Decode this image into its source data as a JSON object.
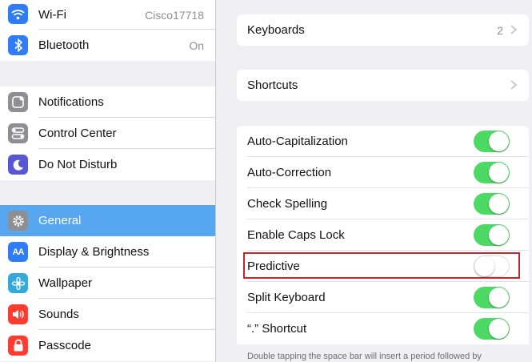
{
  "sidebar": {
    "group1": [
      {
        "label": "Wi-Fi",
        "value": "Cisco17718",
        "icon": "wifi-icon",
        "color": "#2f7cf6"
      },
      {
        "label": "Bluetooth",
        "value": "On",
        "icon": "bluetooth-icon",
        "color": "#2f7cf6"
      }
    ],
    "group2": [
      {
        "label": "Notifications",
        "icon": "notifications-icon",
        "color": "#8e8e93"
      },
      {
        "label": "Control Center",
        "icon": "control-center-icon",
        "color": "#8e8e93"
      },
      {
        "label": "Do Not Disturb",
        "icon": "moon-icon",
        "color": "#5856d6"
      }
    ],
    "group3": [
      {
        "label": "General",
        "icon": "gear-icon",
        "color": "#8e8e93",
        "active": true
      },
      {
        "label": "Display & Brightness",
        "icon": "display-brightness-icon",
        "color": "#2f7cf6"
      },
      {
        "label": "Wallpaper",
        "icon": "wallpaper-icon",
        "color": "#34aadc"
      },
      {
        "label": "Sounds",
        "icon": "speaker-icon",
        "color": "#ff3b30"
      },
      {
        "label": "Passcode",
        "icon": "lock-icon",
        "color": "#ff3b30"
      }
    ],
    "display_icon_text": "AA"
  },
  "keyboards": {
    "label": "Keyboards",
    "value": "2"
  },
  "shortcuts": {
    "label": "Shortcuts"
  },
  "toggles": [
    {
      "label": "Auto-Capitalization",
      "on": true
    },
    {
      "label": "Auto-Correction",
      "on": true
    },
    {
      "label": "Check Spelling",
      "on": true
    },
    {
      "label": "Enable Caps Lock",
      "on": true
    },
    {
      "label": "Predictive",
      "on": false,
      "highlighted": true
    },
    {
      "label": "Split Keyboard",
      "on": true
    },
    {
      "label": "“.” Shortcut",
      "on": true
    }
  ],
  "footnote": "Double tapping the space bar will insert a period followed by",
  "colors": {
    "toggle_on": "#4cd964",
    "active_row": "#57a7f0",
    "highlight_border": "#c6252c"
  }
}
